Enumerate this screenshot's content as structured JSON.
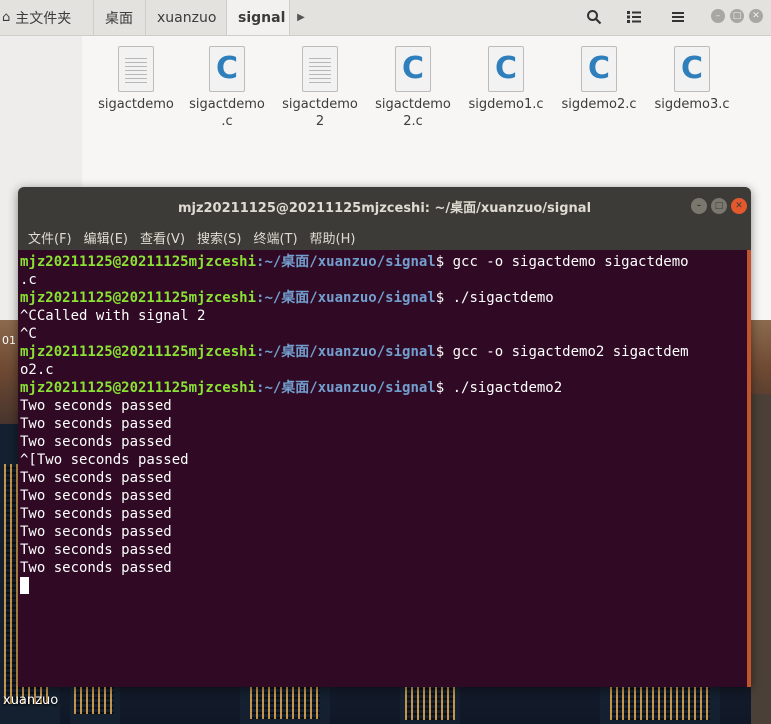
{
  "file_manager": {
    "breadcrumbs": [
      {
        "label": "主文件夹",
        "icon": "home-icon"
      },
      {
        "label": "桌面"
      },
      {
        "label": "xuanzuo"
      },
      {
        "label": "signal",
        "active": true
      }
    ],
    "files": [
      {
        "name_line1": "sigactdemo",
        "name_line2": "",
        "type": "binary",
        "icon": "document-icon"
      },
      {
        "name_line1": "sigactdemo",
        "name_line2": ".c",
        "type": "c",
        "icon": "c-source-icon"
      },
      {
        "name_line1": "sigactdemo",
        "name_line2": "2",
        "type": "binary",
        "icon": "document-icon"
      },
      {
        "name_line1": "sigactdemo",
        "name_line2": "2.c",
        "type": "c",
        "icon": "c-source-icon"
      },
      {
        "name_line1": "sigdemo1.c",
        "name_line2": "",
        "type": "c",
        "icon": "c-source-icon"
      },
      {
        "name_line1": "sigdemo2.c",
        "name_line2": "",
        "type": "c",
        "icon": "c-source-icon"
      },
      {
        "name_line1": "sigdemo3.c",
        "name_line2": "",
        "type": "c",
        "icon": "c-source-icon"
      }
    ]
  },
  "terminal": {
    "title": "mjz20211125@20211125mjzceshi: ~/桌面/xuanzuo/signal",
    "menu": [
      "文件(F)",
      "编辑(E)",
      "查看(V)",
      "搜索(S)",
      "终端(T)",
      "帮助(H)"
    ],
    "user_host": "mjz20211125@20211125mjzceshi",
    "path": ":~/桌面/xuanzuo/signal",
    "lines": [
      {
        "kind": "prompt",
        "cmd": "$ gcc -o sigactdemo sigactdemo"
      },
      {
        "kind": "out",
        "text": ".c"
      },
      {
        "kind": "prompt",
        "cmd": "$ ./sigactdemo"
      },
      {
        "kind": "out",
        "text": "^CCalled with signal 2"
      },
      {
        "kind": "out",
        "text": "^C"
      },
      {
        "kind": "prompt",
        "cmd": "$ gcc -o sigactdemo2 sigactdem"
      },
      {
        "kind": "out",
        "text": "o2.c"
      },
      {
        "kind": "prompt",
        "cmd": "$ ./sigactdemo2"
      },
      {
        "kind": "out",
        "text": "Two seconds passed"
      },
      {
        "kind": "out",
        "text": "Two seconds passed"
      },
      {
        "kind": "out",
        "text": "Two seconds passed"
      },
      {
        "kind": "out",
        "text": "^[Two seconds passed"
      },
      {
        "kind": "out",
        "text": "Two seconds passed"
      },
      {
        "kind": "out",
        "text": "Two seconds passed"
      },
      {
        "kind": "out",
        "text": "Two seconds passed"
      },
      {
        "kind": "out",
        "text": "Two seconds passed"
      },
      {
        "kind": "out",
        "text": "Two seconds passed"
      },
      {
        "kind": "out",
        "text": "Two seconds passed"
      }
    ]
  },
  "desktop": {
    "folder_label": "xuanzuo",
    "edge_text": "01"
  },
  "colors": {
    "terminal_bg": "#300a24",
    "prompt_user": "#8ae234",
    "prompt_path": "#729fcf",
    "titlebar": "#3c3b37",
    "close_button": "#e3582d"
  }
}
